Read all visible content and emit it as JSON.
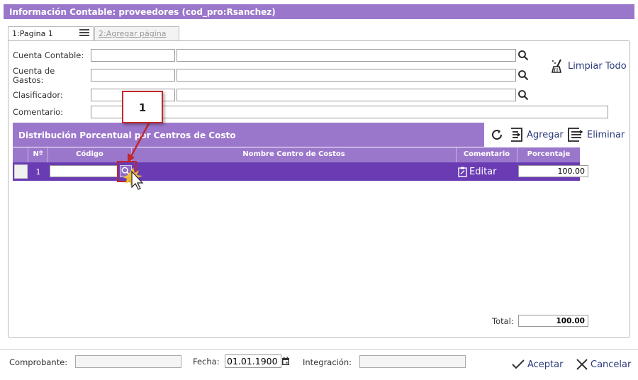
{
  "window": {
    "title": "Información Contable: proveedores (cod_pro:Rsanchez)"
  },
  "tabs": [
    {
      "label": "1:Pagina 1"
    },
    {
      "label": "2:Agregar página"
    }
  ],
  "form": {
    "cuenta_contable_label": "Cuenta Contable:",
    "cuenta_gastos_label": "Cuenta de Gastos:",
    "clasificador_label": "Clasificador:",
    "comentario_label": "Comentario:",
    "limpiar_label": "Limpiar Todo"
  },
  "grid": {
    "title": "Distribución Porcentual por Centros de Costo",
    "agregar_label": "Agregar",
    "eliminar_label": "Eliminar",
    "columns": [
      "Nº",
      "Código",
      "Nombre Centro de Costos",
      "Comentario",
      "Porcentaje"
    ],
    "rows": [
      {
        "n": "1",
        "codigo": "",
        "nombre": "",
        "comentario": "Editar",
        "porcentaje": "100.00"
      }
    ],
    "total_label": "Total:",
    "total_value": "100.00"
  },
  "annotation": {
    "callout": "1"
  },
  "footer": {
    "comprobante_label": "Comprobante:",
    "fecha_label": "Fecha:",
    "fecha_value": "01.01.1900",
    "integracion_label": "Integración:",
    "aceptar_label": "Aceptar",
    "cancelar_label": "Cancelar"
  },
  "colors": {
    "header": "#9b77cc",
    "row": "#6a3cb4",
    "accent_red": "#c1272d",
    "link_blue": "#2b3a7a"
  }
}
